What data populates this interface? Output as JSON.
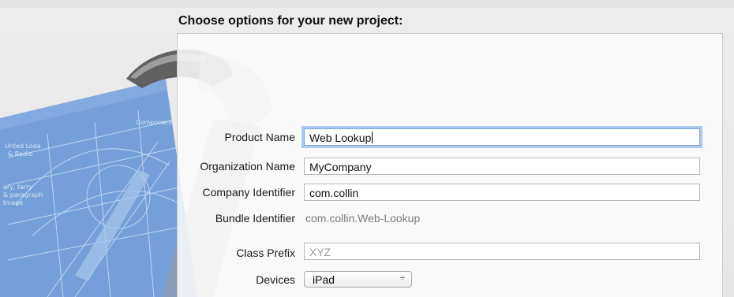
{
  "header": {
    "title": "Choose options for your new project:"
  },
  "form": {
    "product_name": {
      "label": "Product Name",
      "value": "Web Lookup"
    },
    "organization_name": {
      "label": "Organization Name",
      "value": "MyCompany"
    },
    "company_identifier": {
      "label": "Company Identifier",
      "value": "com.collin"
    },
    "bundle_identifier": {
      "label": "Bundle Identifier",
      "value": "com.collin.Web-Lookup"
    },
    "class_prefix": {
      "label": "Class Prefix",
      "placeholder": "XYZ"
    },
    "devices": {
      "label": "Devices",
      "selected": "iPad",
      "arrows": "÷"
    }
  },
  "artwork": {
    "icon": "xcode-hammer-blueprint-icon",
    "blueprint_texts": [
      "Unted Loda",
      "& Radio",
      "Component",
      "ary, tarry",
      "& paragraph",
      "Image"
    ]
  },
  "colors": {
    "focus_ring": "#7aa7dd",
    "blueprint": "#5d8fd0"
  }
}
